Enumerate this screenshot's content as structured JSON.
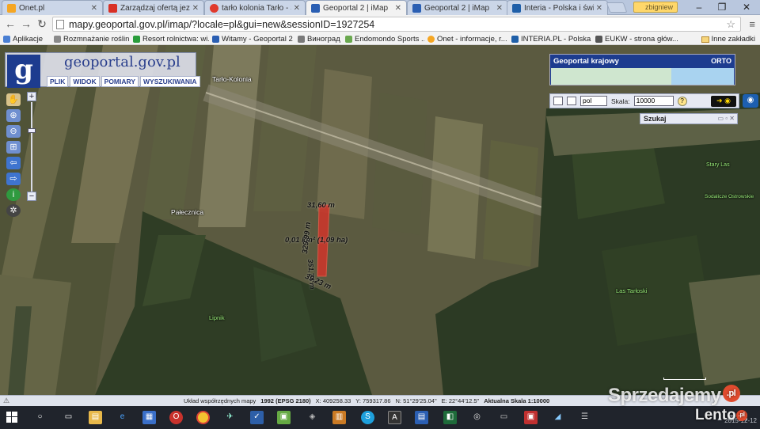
{
  "browser": {
    "tabs": [
      {
        "label": "Onet.pl",
        "color": "#f5a623",
        "active": false
      },
      {
        "label": "Zarządzaj ofertą jeziora",
        "color": "#d93025",
        "active": false
      },
      {
        "label": "tarło kolonia Tarło - Spr",
        "color": "#e03a2c",
        "active": false
      },
      {
        "label": "Geoportal 2 | iMap",
        "color": "#2b5fb3",
        "active": true
      },
      {
        "label": "Geoportal 2 | iMap",
        "color": "#2b5fb3",
        "active": false
      },
      {
        "label": "Interia - Polska i świat",
        "color": "#1f5fa8",
        "active": false
      }
    ],
    "profile_name": "zbigniew",
    "url": "mapy.geoportal.gov.pl/imap/?locale=pl&gui=new&sessionID=1927254",
    "bookmarks": [
      {
        "label": "Aplikacje",
        "color": "#4a7fd3"
      },
      {
        "label": "Rozmnażanie roślin ...",
        "color": "#8a8a8a"
      },
      {
        "label": "Resort rolnictwa: wi...",
        "color": "#2a9d3c"
      },
      {
        "label": "Witamy - Geoportal 2",
        "color": "#2b5fb3"
      },
      {
        "label": "Виноград",
        "color": "#7a7a7a"
      },
      {
        "label": "Endomondo Sports ...",
        "color": "#6aa84f"
      },
      {
        "label": "Onet - informacje, r...",
        "color": "#f5a623"
      },
      {
        "label": "INTERIA.PL - Polska ...",
        "color": "#1f5fa8"
      },
      {
        "label": "EUKW - strona głów...",
        "color": "#555555"
      }
    ],
    "bookmarks_more": "Inne zakładki"
  },
  "geoportal": {
    "logo_letter": "g",
    "logo_text": "geoportal.gov.pl",
    "menu": [
      "PLIK",
      "WIDOK",
      "POMIARY",
      "WYSZUKIWANIA"
    ],
    "overview_title": "Geoportal krajowy",
    "overview_badge": "ORTO",
    "language": "pol",
    "scale_label": "Skala:",
    "scale_value": "10000",
    "search_panel": "Szukaj"
  },
  "map_labels": {
    "tarlo_kolonia": "Tarło-Kolonia",
    "palecznica": "Pałecznica",
    "stary_las": "Stary Las",
    "sodalicze": "Sodalicze Ostrowskie",
    "las_tarlo": "Las Tarłoski",
    "lipnik": "Lipnik"
  },
  "measurements": {
    "top": "31,60 m",
    "area": "0,01 km² (1,09 ha)",
    "left": "329,99 m",
    "right": "351,74 m",
    "bottom": "39,23 m"
  },
  "status": {
    "system_label": "Układ współrzędnych mapy",
    "system_value": "1992 (EPSG 2180)",
    "x": "X: 409258.33",
    "y": "Y: 759317.86",
    "n": "N: 51°29'25.04\"",
    "e": "E: 22°44'12.5\"",
    "scale": "Aktualna Skala 1:10000"
  },
  "taskbar": {
    "clock": "2015-12-12"
  },
  "watermark": {
    "brand": "Sprzedajemy",
    "brand_suffix": ".pl",
    "brand2": "Lento",
    "brand2_suffix": ".pl"
  },
  "colors": {
    "parcel": "#c9372c",
    "geoportal_blue": "#1d3c8f",
    "forest": "#2f3d25",
    "field": "#6b6a4a"
  }
}
